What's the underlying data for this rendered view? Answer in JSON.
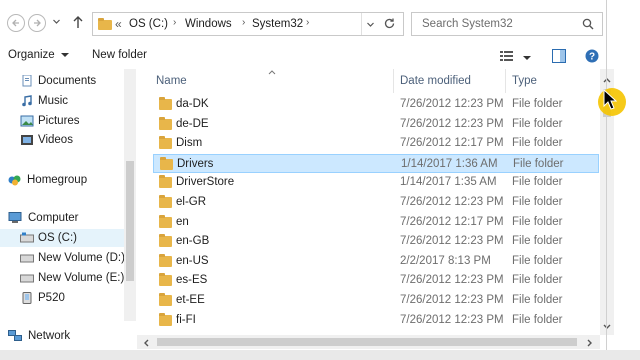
{
  "nav": {
    "back_icon": "back-arrow-icon",
    "forward_icon": "forward-arrow-icon",
    "recent_icon": "chevron-down-icon",
    "up_icon": "up-arrow-icon"
  },
  "address": {
    "overflow": "«",
    "crumbs": [
      "OS (C:)",
      "Windows",
      "System32"
    ],
    "separator": "›"
  },
  "search": {
    "placeholder": "Search System32"
  },
  "toolbar": {
    "organize_label": "Organize",
    "new_folder_label": "New folder"
  },
  "sidebar": {
    "items": [
      {
        "label": "Documents",
        "icon": "documents-icon"
      },
      {
        "label": "Music",
        "icon": "music-icon"
      },
      {
        "label": "Pictures",
        "icon": "pictures-icon"
      },
      {
        "label": "Videos",
        "icon": "videos-icon"
      },
      {
        "label": "Homegroup",
        "icon": "homegroup-icon"
      },
      {
        "label": "Computer",
        "icon": "computer-icon"
      },
      {
        "label": "OS (C:)",
        "icon": "drive-icon"
      },
      {
        "label": "New Volume (D:)",
        "icon": "drive-icon"
      },
      {
        "label": "New Volume (E:)",
        "icon": "drive-icon"
      },
      {
        "label": "P520",
        "icon": "device-icon"
      },
      {
        "label": "Network",
        "icon": "network-icon"
      }
    ]
  },
  "columns": {
    "name": "Name",
    "date": "Date modified",
    "type": "Type"
  },
  "files": [
    {
      "name": "da-DK",
      "date": "7/26/2012 12:23 PM",
      "type": "File folder"
    },
    {
      "name": "de-DE",
      "date": "7/26/2012 12:23 PM",
      "type": "File folder"
    },
    {
      "name": "Dism",
      "date": "7/26/2012 12:17 PM",
      "type": "File folder"
    },
    {
      "name": "Drivers",
      "date": "1/14/2017 1:36 AM",
      "type": "File folder",
      "selected": true
    },
    {
      "name": "DriverStore",
      "date": "1/14/2017 1:35 AM",
      "type": "File folder"
    },
    {
      "name": "el-GR",
      "date": "7/26/2012 12:23 PM",
      "type": "File folder"
    },
    {
      "name": "en",
      "date": "7/26/2012 12:17 PM",
      "type": "File folder"
    },
    {
      "name": "en-GB",
      "date": "7/26/2012 12:23 PM",
      "type": "File folder"
    },
    {
      "name": "en-US",
      "date": "2/2/2017 8:13 PM",
      "type": "File folder"
    },
    {
      "name": "es-ES",
      "date": "7/26/2012 12:23 PM",
      "type": "File folder"
    },
    {
      "name": "et-EE",
      "date": "7/26/2012 12:23 PM",
      "type": "File folder"
    },
    {
      "name": "fi-FI",
      "date": "7/26/2012 12:23 PM",
      "type": "File folder"
    }
  ],
  "colors": {
    "selection_bg": "#cce8ff",
    "selection_border": "#99d1ff",
    "folder": "#e8b64a",
    "header_text": "#4c607a",
    "cursor": "#f5c400"
  }
}
